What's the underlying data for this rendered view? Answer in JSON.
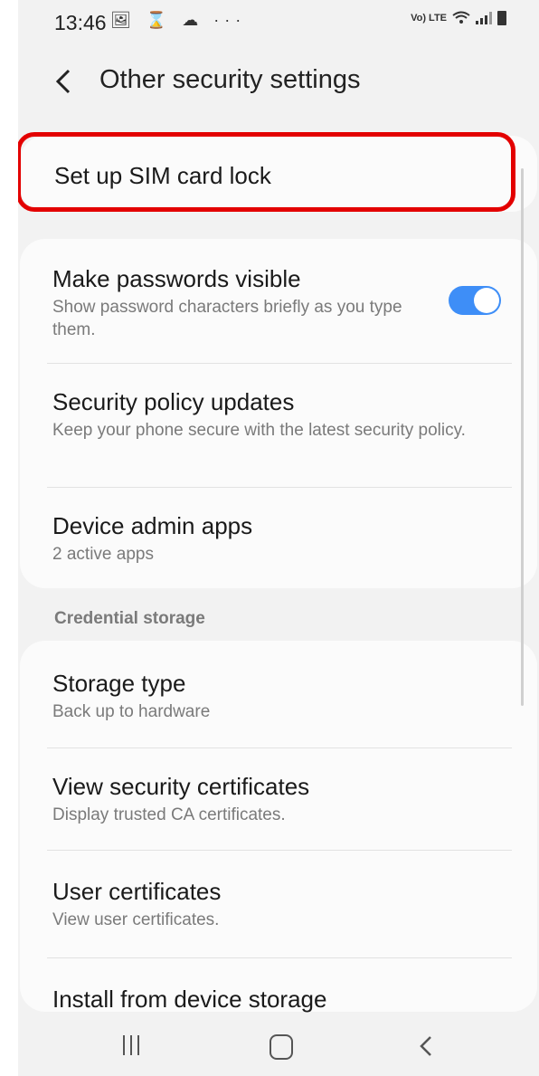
{
  "status_bar": {
    "time": "13:46",
    "left_icons": "🖼 ⌛ ☁ ···",
    "network_label": "Vo) LTE"
  },
  "header": {
    "title": "Other security settings"
  },
  "sim_lock": {
    "title": "Set up SIM card lock"
  },
  "security_items": [
    {
      "title": "Make passwords visible",
      "subtitle": "Show password characters briefly as you type them.",
      "toggle": true
    },
    {
      "title": "Security policy updates",
      "subtitle": "Keep your phone secure with the latest security policy."
    },
    {
      "title": "Device admin apps",
      "subtitle": "2 active apps"
    }
  ],
  "credential_section": {
    "header": "Credential storage",
    "items": [
      {
        "title": "Storage type",
        "subtitle": "Back up to hardware"
      },
      {
        "title": "View security certificates",
        "subtitle": "Display trusted CA certificates."
      },
      {
        "title": "User certificates",
        "subtitle": "View user certificates."
      },
      {
        "title": "Install from device storage"
      }
    ]
  },
  "colors": {
    "highlight": "#e30000",
    "toggle_on": "#3e8ef7"
  }
}
